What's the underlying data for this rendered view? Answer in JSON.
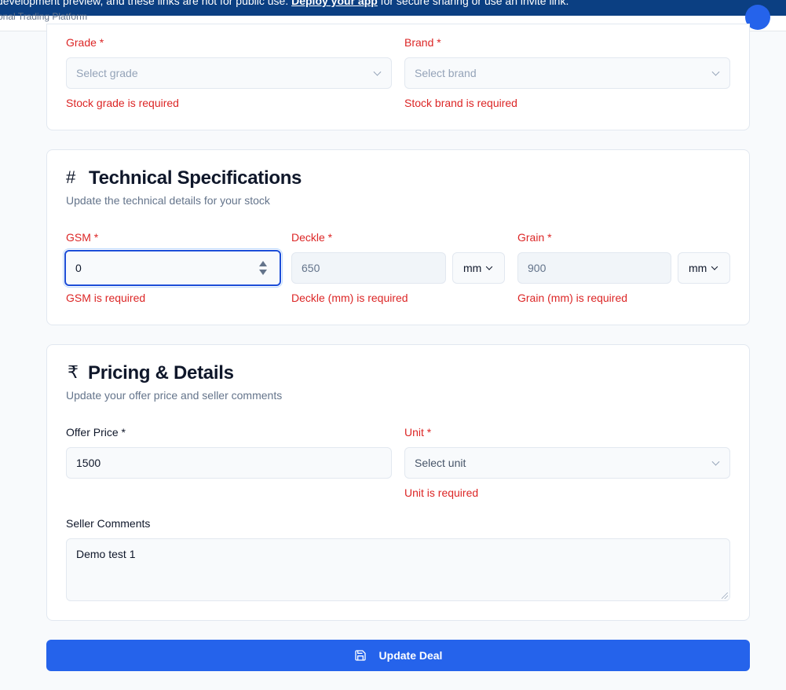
{
  "banner": {
    "text_before": "development preview, and these links are not for public use. ",
    "link": "Deploy your app",
    "text_after": " for secure sharing or use an invite link."
  },
  "header": {
    "subtitle": "onal Trading Platform"
  },
  "stock_section": {
    "grade": {
      "label": "Grade *",
      "placeholder": "Select grade",
      "error": "Stock grade is required"
    },
    "brand": {
      "label": "Brand *",
      "placeholder": "Select brand",
      "error": "Stock brand is required"
    }
  },
  "technical": {
    "icon": "#",
    "title": "Technical Specifications",
    "subtitle": "Update the technical details for your stock",
    "gsm": {
      "label": "GSM *",
      "value": "0",
      "error": "GSM is required"
    },
    "deckle": {
      "label": "Deckle *",
      "value": "650",
      "unit": "mm",
      "error": "Deckle (mm) is required"
    },
    "grain": {
      "label": "Grain *",
      "value": "900",
      "unit": "mm",
      "error": "Grain (mm) is required"
    }
  },
  "pricing": {
    "icon": "₹",
    "title": "Pricing & Details",
    "subtitle": "Update your offer price and seller comments",
    "offer_price": {
      "label": "Offer Price *",
      "value": "1500"
    },
    "unit": {
      "label": "Unit *",
      "placeholder": "Select unit",
      "error": "Unit is required"
    },
    "comments": {
      "label": "Seller Comments",
      "value": "Demo test 1"
    }
  },
  "actions": {
    "update_label": "Update Deal"
  },
  "colors": {
    "primary": "#2563eb",
    "error": "#dc2626",
    "banner": "#0b3f82"
  }
}
